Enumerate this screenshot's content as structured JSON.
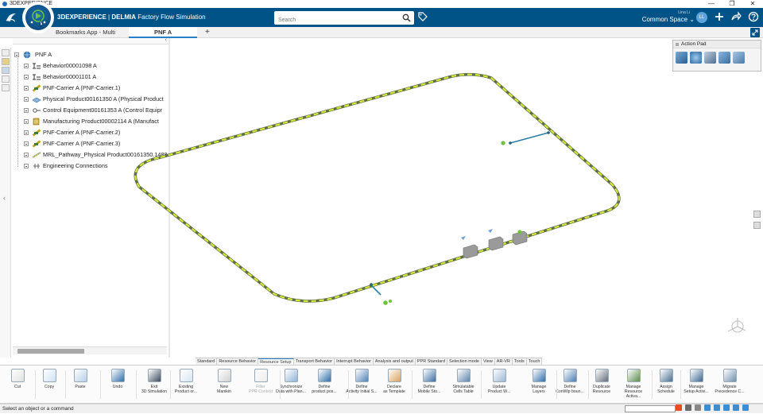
{
  "window": {
    "title": "3DEXPERIENCE",
    "controls": [
      "—",
      "❐",
      "✕"
    ]
  },
  "topbar": {
    "brand": "3DEXPERIENCE",
    "separator": " | ",
    "app_brand": "DELMIA",
    "app_name": "Factory Flow Simulation",
    "search_placeholder": "Search",
    "user_name": "Lina Li",
    "space": "Common Space",
    "space_caret": "⌄",
    "avatar_initials": "LL",
    "accent": "#005386"
  },
  "tabs": [
    {
      "label": "Bookmarks App - Multi"
    },
    {
      "label": "PNF A"
    },
    {
      "label": "+"
    }
  ],
  "tree": {
    "root": "PNF A",
    "items": [
      {
        "label": "Behavior00001098 A"
      },
      {
        "label": "Behavior00001101 A"
      },
      {
        "label": "PNF-Carrier A (PNF-Carrier.1)"
      },
      {
        "label": "Physical Product00161350 A (Physical Product"
      },
      {
        "label": "Control Equipment00161353 A (Control Equipr"
      },
      {
        "label": "Manufacturing Product00002114 A (Manufact"
      },
      {
        "label": "PNF-Carrier A (PNF-Carrier.2)"
      },
      {
        "label": "PNF-Carrier A (PNF-Carrier.3)"
      },
      {
        "label": "MRL_Pathway_Physical Product00161350.1488."
      },
      {
        "label": "Engineering Connections"
      }
    ]
  },
  "action_pad": {
    "title": "Action Pad",
    "icons": [
      "tools-icon",
      "settings-sphere-icon",
      "robot-icon",
      "conveyor-icon",
      "transfer-icon"
    ]
  },
  "command_tabs": [
    {
      "label": "Standard"
    },
    {
      "label": "Resource Behavior"
    },
    {
      "label": "Resource Setup",
      "active": true
    },
    {
      "label": "Transport Behavior"
    },
    {
      "label": "Interrupt Behavior"
    },
    {
      "label": "Analysis and output"
    },
    {
      "label": "PPR Standard"
    },
    {
      "label": "Selection mode"
    },
    {
      "label": "View"
    },
    {
      "label": "AR-VR"
    },
    {
      "label": "Tools"
    },
    {
      "label": "Touch"
    }
  ],
  "ribbon": [
    {
      "l1": "Cut",
      "l2": ""
    },
    {
      "l1": "Copy",
      "l2": ""
    },
    {
      "l1": "Paste",
      "l2": ""
    },
    {
      "l1": "Undo",
      "l2": ""
    },
    {
      "l1": "Exit",
      "l2": "3D Simulation"
    },
    {
      "l1": "Existing",
      "l2": "Product or..."
    },
    {
      "l1": "New",
      "l2": "Manikin"
    },
    {
      "l1": "Filter",
      "l2": "PPR Context"
    },
    {
      "l1": "Synchronize",
      "l2": "Data with Plan..."
    },
    {
      "l1": "Define",
      "l2": "product pos..."
    },
    {
      "l1": "Define",
      "l2": "Activity Initial S..."
    },
    {
      "l1": "Declare",
      "l2": "as Template"
    },
    {
      "l1": "Define",
      "l2": "Mobile Sto..."
    },
    {
      "l1": "Simulatable",
      "l2": "Cells Table"
    },
    {
      "l1": "Update",
      "l2": "Product W..."
    },
    {
      "l1": "Manage",
      "l2": "Layers"
    },
    {
      "l1": "Define",
      "l2": "ConWip boun..."
    },
    {
      "l1": "Duplicate",
      "l2": "Resource"
    },
    {
      "l1": "Manage",
      "l2": "Resource Activa..."
    },
    {
      "l1": "Assign",
      "l2": "Schedule"
    },
    {
      "l1": "Manage",
      "l2": "Setup Activi..."
    },
    {
      "l1": "Migrate",
      "l2": "Precedence C..."
    }
  ],
  "status": {
    "message": "Select an object or a command"
  }
}
